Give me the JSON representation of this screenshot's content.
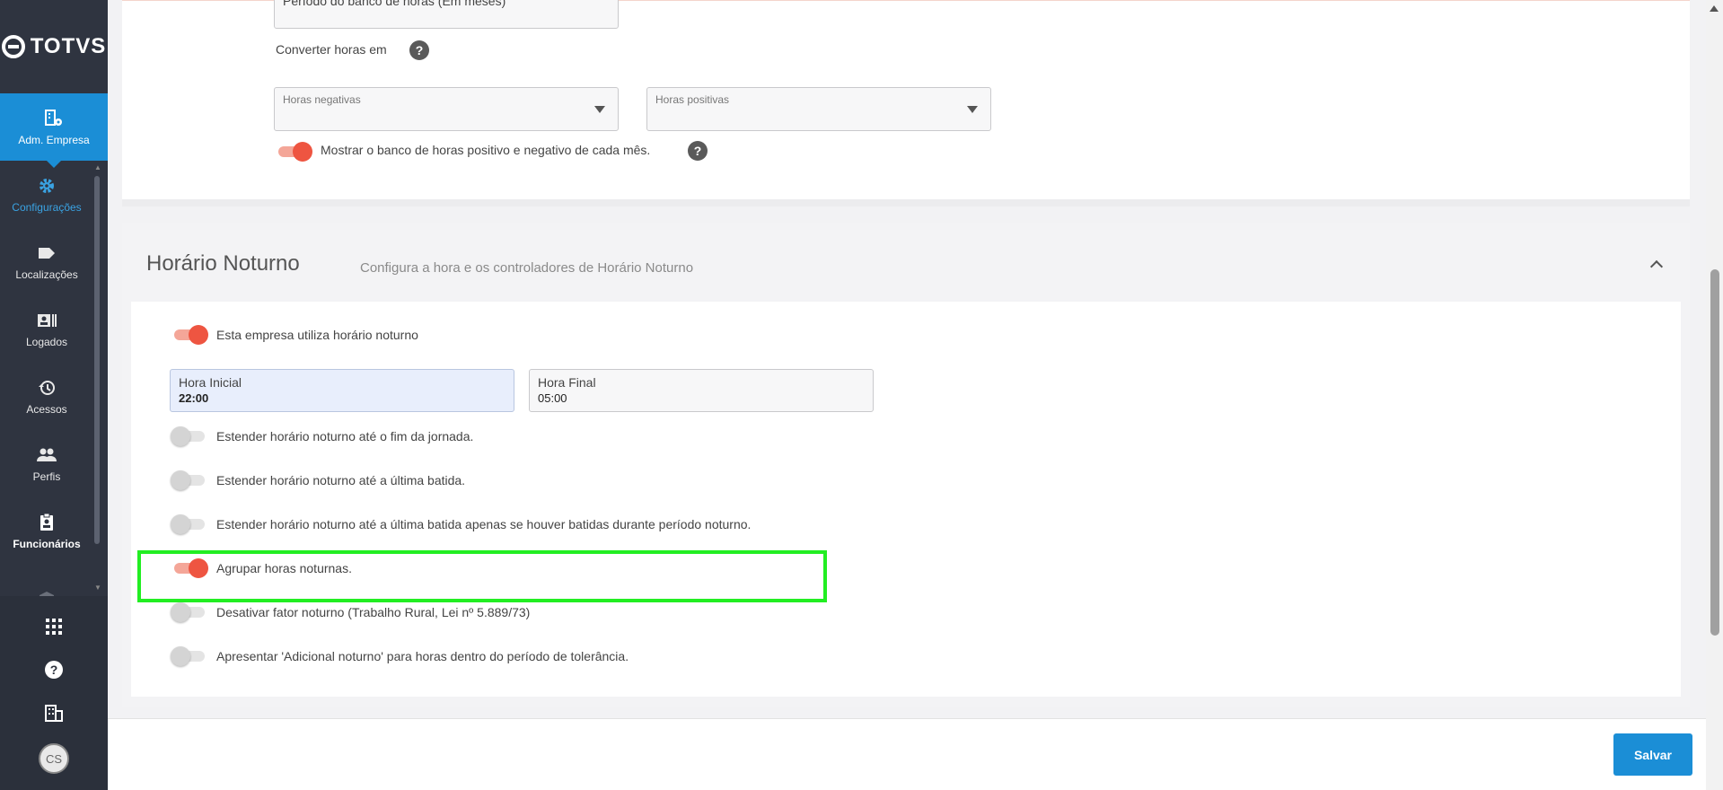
{
  "brand": {
    "name": "TOTVS"
  },
  "sidebar": {
    "active_module": {
      "label": "Adm. Empresa",
      "icon": "company-settings-icon"
    },
    "items": [
      {
        "label": "Configurações",
        "icon": "gear-icon"
      },
      {
        "label": "Localizações",
        "icon": "tag-icon"
      },
      {
        "label": "Logados",
        "icon": "id-card-icon"
      },
      {
        "label": "Acessos",
        "icon": "history-icon"
      },
      {
        "label": "Perfis",
        "icon": "users-icon"
      },
      {
        "label": "Funcionários",
        "icon": "badge-icon"
      }
    ],
    "bottom": {
      "avatar_initials": "CS"
    }
  },
  "bank_hours": {
    "period_placeholder": "Período do banco de horas (Em meses)",
    "convert_label": "Converter horas em",
    "negative_placeholder": "Horas negativas",
    "positive_placeholder": "Horas positivas",
    "show_monthly_label": "Mostrar o banco de horas positivo e negativo de cada mês.",
    "show_monthly_on": true
  },
  "night_shift": {
    "title": "Horário Noturno",
    "subtitle": "Configura a hora e os controladores de Horário Noturno",
    "uses_night_label": "Esta empresa utiliza horário noturno",
    "uses_night_on": true,
    "start": {
      "label": "Hora Inicial",
      "value": "22:00"
    },
    "end": {
      "label": "Hora Final",
      "value": "05:00"
    },
    "options": [
      {
        "label": "Estender horário noturno até o fim da jornada.",
        "on": false
      },
      {
        "label": "Estender horário noturno até a última batida.",
        "on": false
      },
      {
        "label": "Estender horário noturno até a última batida apenas se houver batidas durante período noturno.",
        "on": false
      },
      {
        "label": "Agrupar horas noturnas.",
        "on": true
      },
      {
        "label": "Desativar fator noturno (Trabalho Rural, Lei nº 5.889/73)",
        "on": false
      },
      {
        "label": "Apresentar 'Adicional noturno' para horas dentro do período de tolerância.",
        "on": false
      }
    ]
  },
  "footer": {
    "save_label": "Salvar"
  },
  "colors": {
    "primary": "#1b8ed6",
    "toggle_on": "#ee5541",
    "highlight": "#22ee22",
    "sidebar": "#2f3440"
  }
}
